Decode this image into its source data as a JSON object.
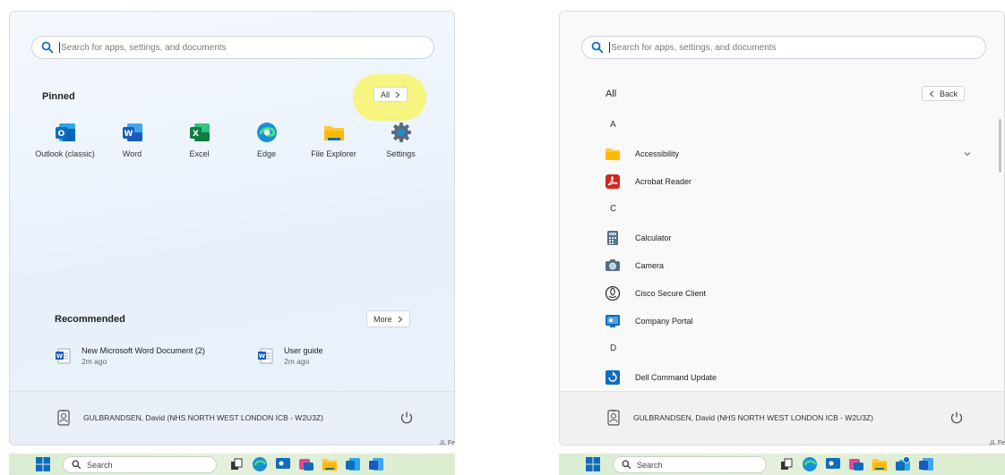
{
  "search": {
    "placeholder": "Search for apps, settings, and documents"
  },
  "left_panel": {
    "pinned_title": "Pinned",
    "all_button": "All",
    "pinned": [
      {
        "label": "Outlook (classic)",
        "icon": "outlook-icon"
      },
      {
        "label": "Word",
        "icon": "word-icon"
      },
      {
        "label": "Excel",
        "icon": "excel-icon"
      },
      {
        "label": "Edge",
        "icon": "edge-icon"
      },
      {
        "label": "File Explorer",
        "icon": "file-explorer-icon"
      },
      {
        "label": "Settings",
        "icon": "settings-gear-icon"
      }
    ],
    "recommended_title": "Recommended",
    "more_button": "More",
    "recommended": [
      {
        "name": "New Microsoft Word Document (2)",
        "time": "2m ago"
      },
      {
        "name": "User guide",
        "time": "2m ago"
      }
    ]
  },
  "right_panel": {
    "all_title": "All",
    "back_button": "Back",
    "list": [
      {
        "type": "letter",
        "text": "A"
      },
      {
        "type": "app",
        "text": "Accessibility",
        "icon": "folder-icon",
        "expandable": true
      },
      {
        "type": "app",
        "text": "Acrobat Reader",
        "icon": "acrobat-icon"
      },
      {
        "type": "letter",
        "text": "C"
      },
      {
        "type": "app",
        "text": "Calculator",
        "icon": "calculator-icon"
      },
      {
        "type": "app",
        "text": "Camera",
        "icon": "camera-icon"
      },
      {
        "type": "app",
        "text": "Cisco Secure Client",
        "icon": "cisco-icon"
      },
      {
        "type": "app",
        "text": "Company Portal",
        "icon": "company-portal-icon"
      },
      {
        "type": "letter",
        "text": "D"
      },
      {
        "type": "app",
        "text": "Dell Command Update",
        "icon": "dell-update-icon"
      }
    ]
  },
  "footer": {
    "user_name": "GULBRANDSEN, David (NHS NORTH WEST LONDON ICB - W2U3Z)"
  },
  "taskbar": {
    "search_label": "Search",
    "corner_text": "ᒧᒪ Fe"
  },
  "colors": {
    "highlight": "#f6f56a",
    "accent_blue": "#0f6cbd"
  }
}
